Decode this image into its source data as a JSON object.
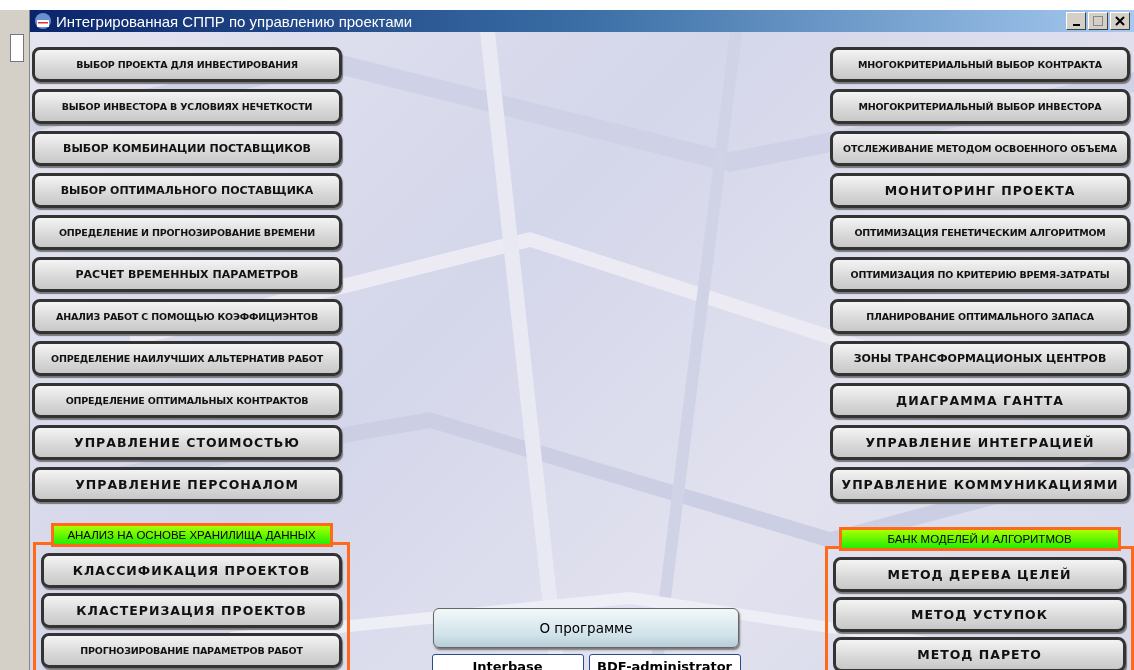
{
  "window": {
    "title": "Интегрированная СППР по управлению проектами"
  },
  "left_buttons": [
    "ВЫБОР  ПРОЕКТА ДЛЯ ИНВЕСТИРОВАНИЯ",
    "ВЫБОР ИНВЕСТОРА В  УСЛОВИЯХ НЕЧЕТКОСТИ",
    "ВЫБОР КОМБИНАЦИИ ПОСТАВЩИКОВ",
    "ВЫБОР ОПТИМАЛЬНОГО ПОСТАВЩИКА",
    "ОПРЕДЕЛЕНИЕ И ПРОГНОЗИРОВАНИЕ ВРЕМЕНИ",
    "РАСЧЕТ ВРЕМЕННЫХ ПАРАМЕТРОВ",
    "АНАЛИЗ РАБОТ С ПОМОЩЬЮ КОЭФФИЦИЭНТОВ",
    "ОПРЕДЕЛЕНИЕ НАИЛУЧШИХ АЛЬТЕРНАТИВ РАБОТ",
    "ОПРЕДЕЛЕНИЕ ОПТИМАЛЬНЫХ КОНТРАКТОВ",
    "УПРАВЛЕНИЕ СТОИМОСТЬЮ",
    "УПРАВЛЕНИЕ ПЕРСОНАЛОМ"
  ],
  "left_group": {
    "title": "АНАЛИЗ НА ОСНОВЕ ХРАНИЛИЩА ДАННЫХ",
    "buttons": [
      "КЛАССИФИКАЦИЯ ПРОЕКТОВ",
      "КЛАСТЕРИЗАЦИЯ ПРОЕКТОВ",
      "ПРОГНОЗИРОВАНИЕ ПАРАМЕТРОВ РАБОТ"
    ]
  },
  "center": {
    "about_button": "О программе",
    "tool_buttons": [
      "Interbase",
      "BDF-administrator"
    ]
  },
  "right_buttons": [
    "МНОГОКРИТЕРИАЛЬНЫЙ ВЫБОР КОНТРАКТА",
    "МНОГОКРИТЕРИАЛЬНЫЙ ВЫБОР ИНВЕСТОРА",
    "ОТСЛЕЖИВАНИЕ МЕТОДОМ ОСВОЕННОГО ОБЪЕМА",
    "МОНИТОРИНГ ПРОЕКТА",
    "ОПТИМИЗАЦИЯ ГЕНЕТИЧЕСКИМ АЛГОРИТМОМ",
    "ОПТИМИЗАЦИЯ ПО КРИТЕРИЮ ВРЕМЯ-ЗАТРАТЫ",
    "ПЛАНИРОВАНИЕ ОПТИМАЛЬНОГО ЗАПАСА",
    "ЗОНЫ ТРАНСФОРМАЦИОНЫХ ЦЕНТРОВ",
    "ДИАГРАММА ГАНТТА",
    "УПРАВЛЕНИЕ ИНТЕГРАЦИЕЙ",
    "УПРАВЛЕНИЕ КОММУНИКАЦИЯМИ"
  ],
  "right_group": {
    "title": "БАНК МОДЕЛЕЙ И АЛГОРИТМОВ",
    "buttons": [
      "МЕТОД ДЕРЕВА ЦЕЛЕЙ",
      "МЕТОД УСТУПОК",
      "МЕТОД ПАРЕТО"
    ]
  }
}
